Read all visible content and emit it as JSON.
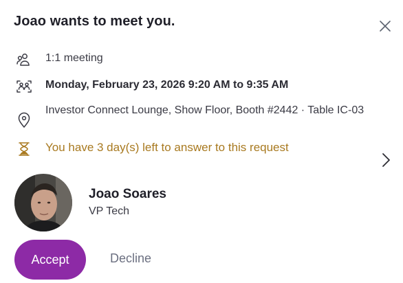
{
  "header": {
    "title": "Joao wants to meet you."
  },
  "details": {
    "meeting_type": "1:1 meeting",
    "time": "Monday, February 23, 2026 9:20 AM to 9:35 AM",
    "location": "Investor Connect Lounge, Show Floor, Booth #2442 · Table IC-03",
    "deadline": "You have 3 day(s) left to answer to this request"
  },
  "person": {
    "name": "Joao Soares",
    "role": "VP Tech"
  },
  "actions": {
    "accept_label": "Accept",
    "decline_label": "Decline"
  },
  "colors": {
    "accent": "#8d2aa6",
    "deadline": "#a8791f",
    "decline": "#6b6f80"
  },
  "icons": [
    "close-icon",
    "people-icon",
    "calendar-people-icon",
    "location-pin-icon",
    "hourglass-icon",
    "chevron-right-icon"
  ]
}
